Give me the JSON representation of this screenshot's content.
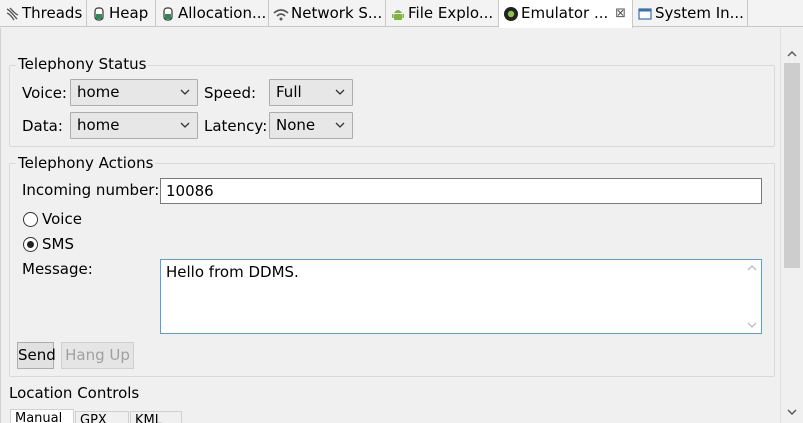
{
  "tabs": [
    {
      "label": "Threads",
      "icon": "threads-icon"
    },
    {
      "label": "Heap",
      "icon": "heap-icon"
    },
    {
      "label": "Allocation...",
      "icon": "allocation-icon"
    },
    {
      "label": "Network S...",
      "icon": "wifi-icon"
    },
    {
      "label": "File Explo...",
      "icon": "android-icon"
    },
    {
      "label": "Emulator ...",
      "icon": "emulator-icon",
      "active": true,
      "close": "⊠"
    },
    {
      "label": "System In...",
      "icon": "window-icon"
    }
  ],
  "telephony_status": {
    "title": "Telephony Status",
    "voice_label": "Voice:",
    "voice_value": "home",
    "speed_label": "Speed:",
    "speed_value": "Full",
    "data_label": "Data:",
    "data_value": "home",
    "latency_label": "Latency:",
    "latency_value": "None"
  },
  "telephony_actions": {
    "title": "Telephony Actions",
    "incoming_label": "Incoming number:",
    "incoming_value": "10086",
    "voice_radio": "Voice",
    "sms_radio": "SMS",
    "selected": "SMS",
    "message_label": "Message:",
    "message_value": "Hello from DDMS.",
    "send_button": "Send",
    "hangup_button": "Hang Up"
  },
  "location_controls": {
    "title": "Location Controls",
    "tabs": [
      "Manual",
      "GPX",
      "KML"
    ]
  },
  "colors": {
    "accent_border": "#569de5",
    "disabled_text": "#a0a0a0"
  }
}
